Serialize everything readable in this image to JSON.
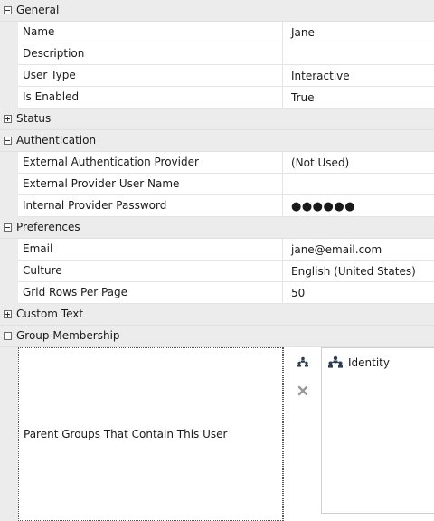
{
  "categories": {
    "general": "General",
    "status": "Status",
    "authentication": "Authentication",
    "preferences": "Preferences",
    "custom_text": "Custom Text",
    "group_membership": "Group Membership"
  },
  "general": {
    "name_label": "Name",
    "name_value": "Jane",
    "description_label": "Description",
    "description_value": "",
    "user_type_label": "User Type",
    "user_type_value": "Interactive",
    "is_enabled_label": "Is Enabled",
    "is_enabled_value": "True"
  },
  "authentication": {
    "ext_provider_label": "External Authentication Provider",
    "ext_provider_value": "(Not Used)",
    "ext_user_label": "External Provider User Name",
    "ext_user_value": "",
    "int_password_label": "Internal Provider Password",
    "int_password_value": "●●●●●●"
  },
  "preferences": {
    "email_label": "Email",
    "email_value": "jane@email.com",
    "culture_label": "Culture",
    "culture_value": "English (United States)",
    "grid_rows_label": "Grid Rows Per Page",
    "grid_rows_value": "50"
  },
  "group_membership": {
    "parent_groups_label": "Parent Groups That Contain This User",
    "groups": [
      "Identity"
    ],
    "icons": {
      "add": "add-group-icon",
      "remove": "remove-icon",
      "group": "group-icon"
    }
  },
  "colors": {
    "category_bg": "#ececec",
    "grid_line": "#e4e4e4",
    "remove_icon": "#9a9a9a",
    "group_icon": "#2d3e50"
  }
}
